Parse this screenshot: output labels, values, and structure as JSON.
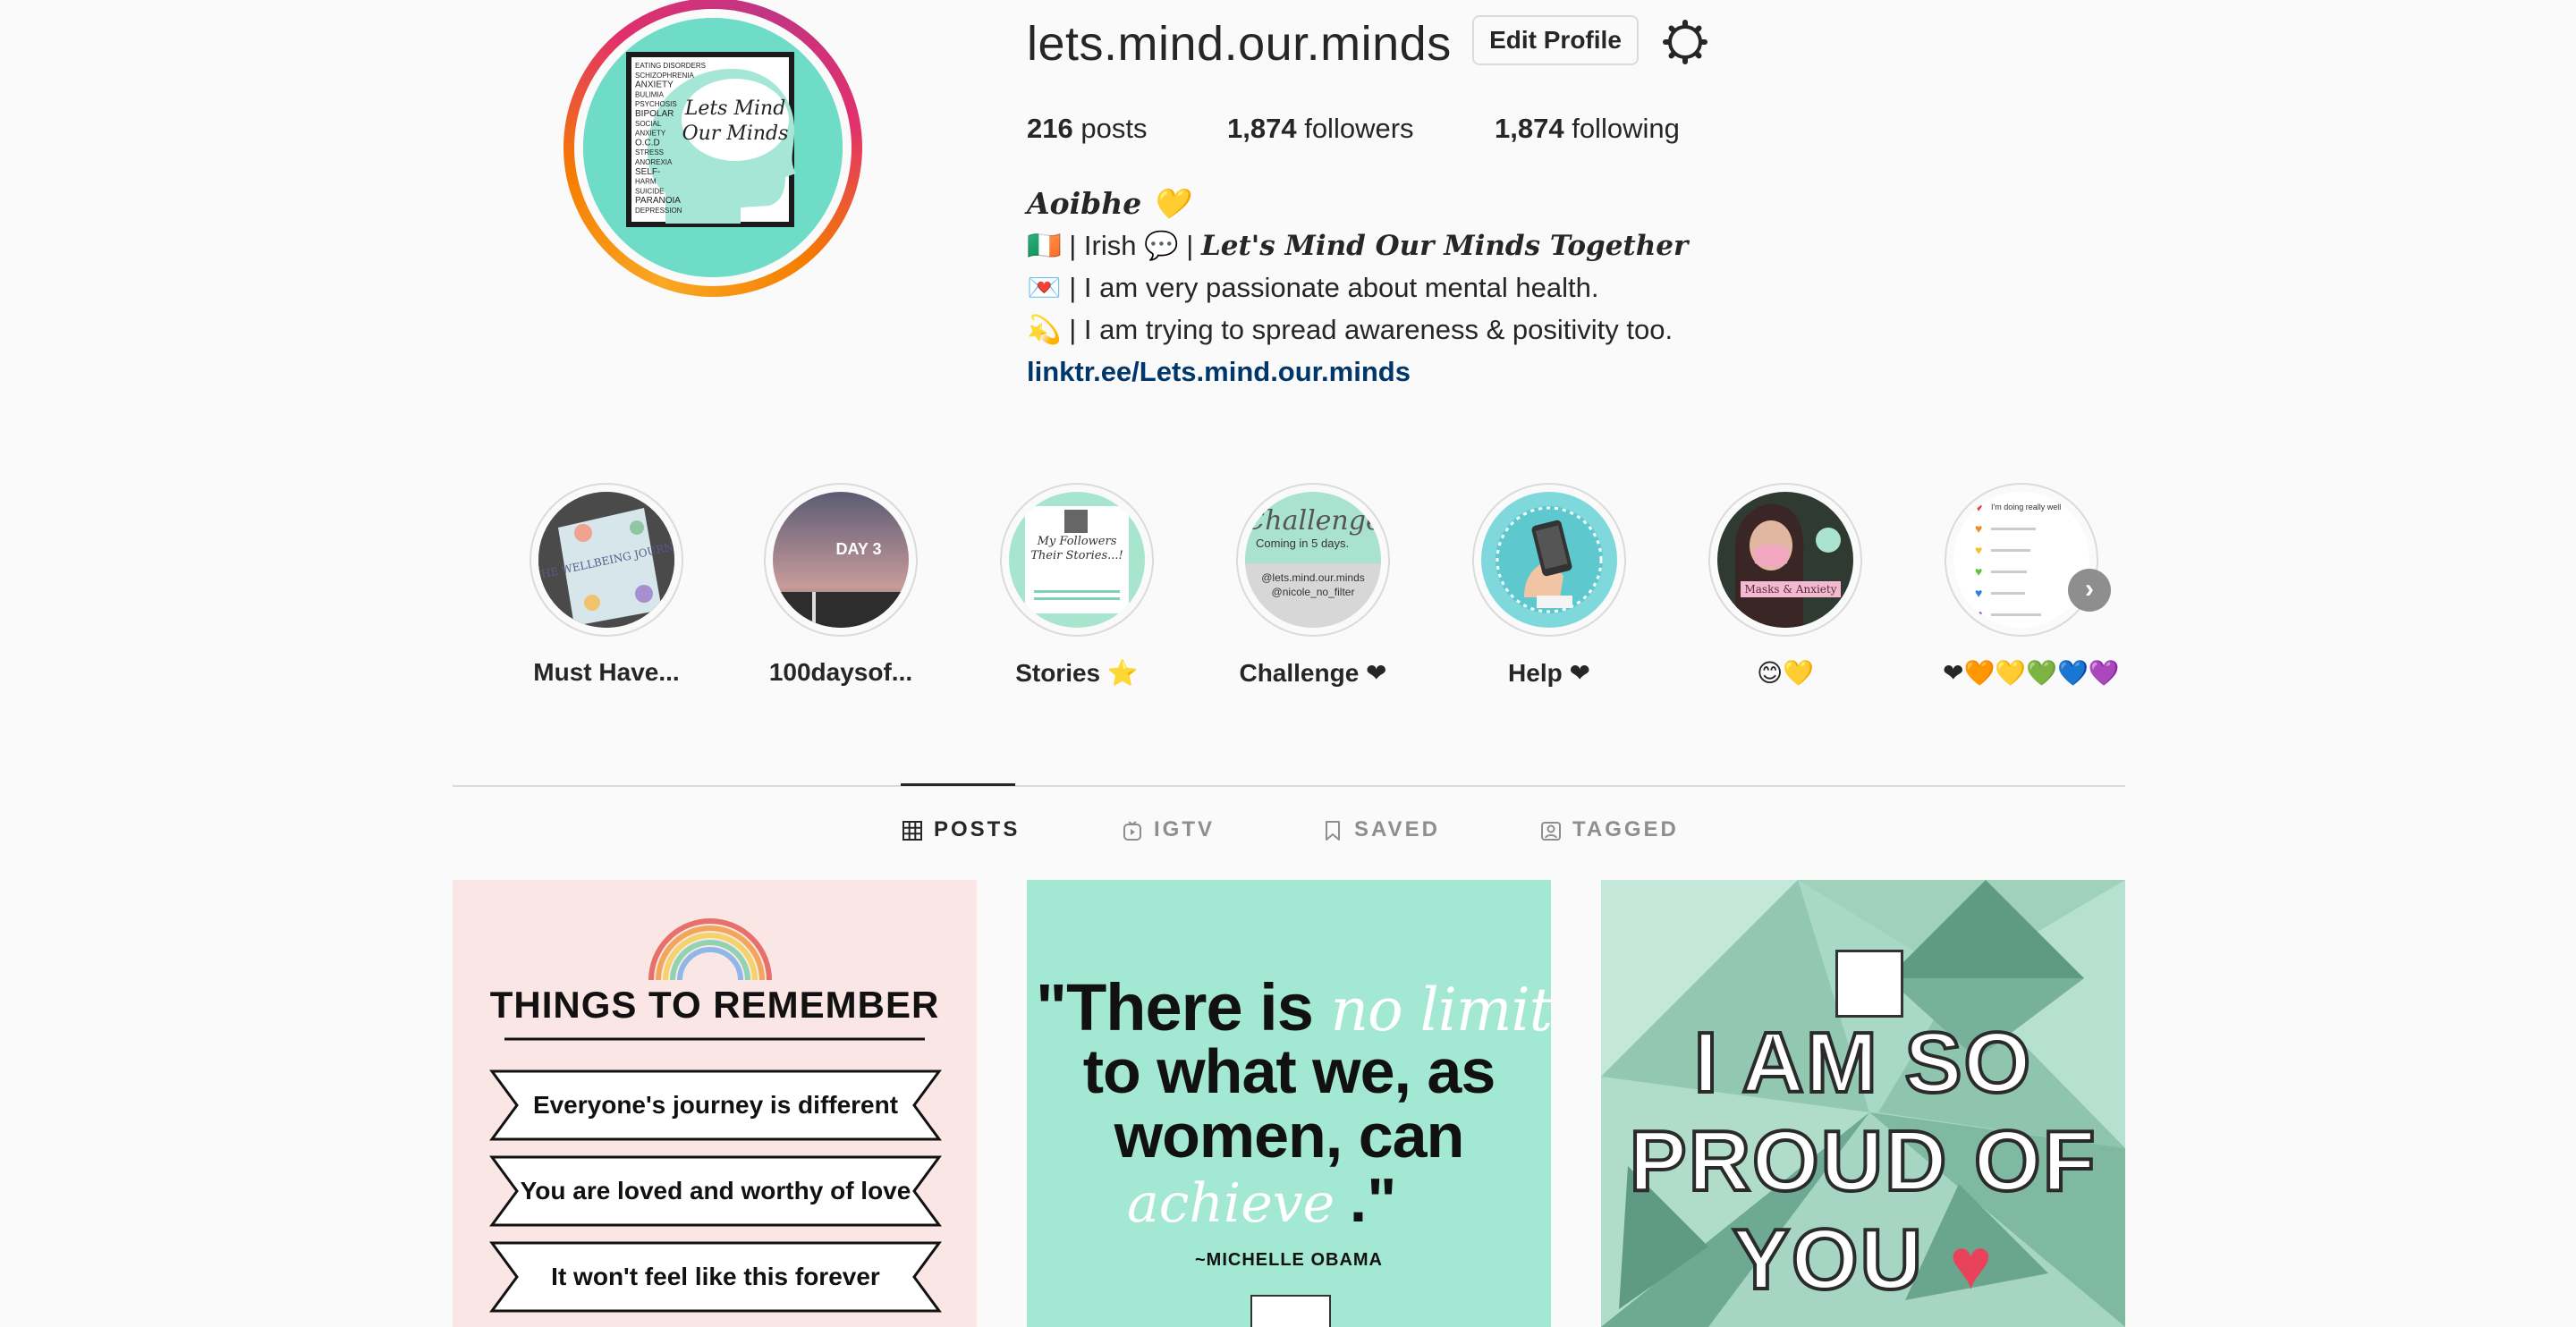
{
  "profile": {
    "username": "lets.mind.our.minds",
    "edit_label": "Edit Profile",
    "stats": {
      "posts_count": "216",
      "posts_label": "posts",
      "followers_count": "1,874",
      "followers_label": "followers",
      "following_count": "1,874",
      "following_label": "following"
    },
    "bio": {
      "name": "Aoibhe 💛",
      "line1_prefix": "🇮🇪 | Irish 💬 | ",
      "line1_italic": "Let's Mind Our Minds Together",
      "line2": "💌 | I am very passionate about mental health.",
      "line3": "💫 | I am trying to spread awareness & positivity too.",
      "link": "linktr.ee/Lets.mind.our.minds"
    },
    "avatar_text": {
      "title_line1": "Lets Mind",
      "title_line2": "Our Minds",
      "words": [
        "EATING DISORDERS",
        "SCHIZOPHRENIA",
        "ANXIETY",
        "BULIMIA",
        "PSYCHOSIS",
        "BIPOLAR",
        "SOCIAL",
        "ANXIETY",
        "O.C.D",
        "STRESS",
        "ANOREXIA",
        "SELF-",
        "HARM",
        "SUICIDE",
        "PARANOIA",
        "DEPRESSION"
      ]
    }
  },
  "highlights": [
    {
      "label": "Must Have...",
      "img_text": "THE WELLBEING JOURNAL"
    },
    {
      "label": "100daysof...",
      "img_text": "DAY 3"
    },
    {
      "label": "Stories ⭐",
      "img_text": "My Followers Their Stories...!"
    },
    {
      "label": "Challenge ❤",
      "img_text": "Challenge",
      "img_sub": "Coming in 5 days.",
      "img_handles": "@lets.mind.our.minds @nicole_no_filter"
    },
    {
      "label": "Help ❤",
      "img_text": ""
    },
    {
      "label": "😊💛",
      "img_text": "Masks & Anxiety"
    },
    {
      "label": "❤🧡💛💚💙💜",
      "img_text": "I'm doing really well"
    }
  ],
  "tabs": [
    {
      "label": "POSTS",
      "icon": "grid-icon",
      "active": true
    },
    {
      "label": "IGTV",
      "icon": "igtv-icon",
      "active": false
    },
    {
      "label": "SAVED",
      "icon": "bookmark-icon",
      "active": false
    },
    {
      "label": "TAGGED",
      "icon": "tag-icon",
      "active": false
    }
  ],
  "posts": [
    {
      "title": "THINGS TO REMEMBER",
      "items": [
        "Everyone's journey is different",
        "You are loved and worthy of love",
        "It won't feel like this forever"
      ]
    },
    {
      "quote_start": "\"There is",
      "quote_script1": "no limit",
      "quote_mid1": "to what we, as",
      "quote_mid2": "women, can",
      "quote_script2": "achieve",
      "quote_end": ".\"",
      "attribution": "~MICHELLE OBAMA"
    },
    {
      "lines": [
        "I AM SO",
        "PROUD OF",
        "YOU"
      ],
      "heart": "♥"
    }
  ],
  "colors": {
    "accent_link": "#00376b",
    "text": "#262626",
    "muted": "#8e8e8e",
    "border": "#dbdbdb",
    "mint": "#6fdcc7"
  }
}
